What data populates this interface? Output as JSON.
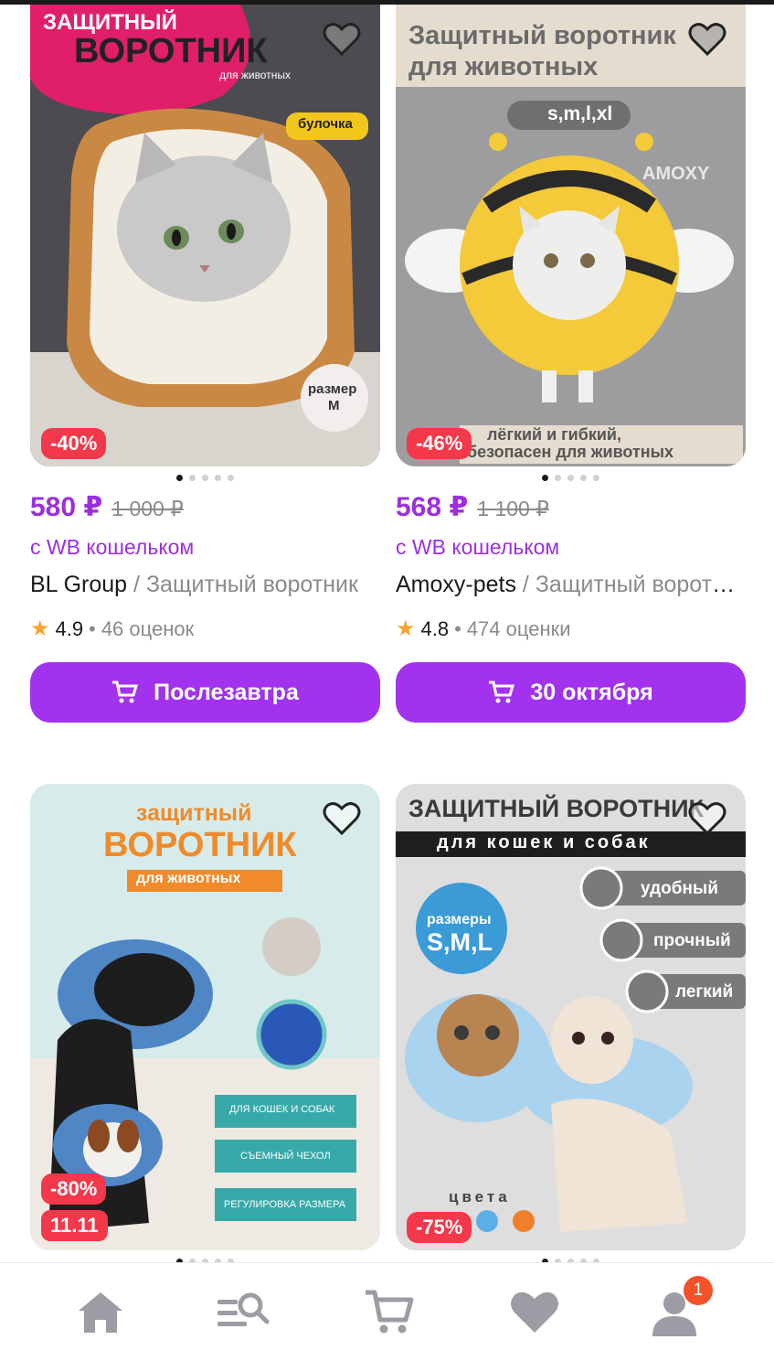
{
  "products": [
    {
      "price": "580 ₽",
      "old_price": "1 000 ₽",
      "wallet": "с WB кошельком",
      "brand": "BL Group",
      "separator": " / ",
      "name": "Защитный воротник",
      "rating": "4.9",
      "reviews": "46 оценок",
      "delivery": "Послезавтра",
      "discount": "-40%",
      "image_text": {
        "t1": "ЗАЩИТНЫЙ",
        "t2": "ВОРОТНИК",
        "t3": "для животных",
        "t4": "булочка",
        "t5": "размер",
        "t6": "M"
      }
    },
    {
      "price": "568 ₽",
      "old_price": "1 100 ₽",
      "wallet": "с WB кошельком",
      "brand": "Amoxy-pets",
      "separator": " / ",
      "name": "Защитный воротник",
      "rating": "4.8",
      "reviews": "474 оценки",
      "delivery": "30 октября",
      "discount": "-46%",
      "image_text": {
        "t1": "Защитный воротник",
        "t2": "для животных",
        "t3": "s,m,l,xl",
        "t4": "AMOXY",
        "t5": "лёгкий и гибкий,",
        "t6": "безопасен для животных"
      }
    },
    {
      "discount": "-80%",
      "promo": "11.11",
      "image_text": {
        "t1": "защитный",
        "t2": "ВОРОТНИК",
        "t3": "для животных",
        "t4": "ДЛЯ КОШЕК И СОБАК",
        "t5": "СЪЕМНЫЙ ЧЕХОЛ",
        "t6": "РЕГУЛИРОВКА РАЗМЕРА"
      }
    },
    {
      "discount": "-75%",
      "image_text": {
        "t1": "ЗАЩИТНЫЙ ВОРОТНИК",
        "t2": "для кошек и собак",
        "t3": "размеры",
        "t4": "S,M,L",
        "t5": "удобный",
        "t6": "прочный",
        "t7": "легкий",
        "t8": "цвета"
      }
    }
  ],
  "nav": {
    "items": [
      "home-icon",
      "catalog-search-icon",
      "cart-icon",
      "favorites-icon",
      "profile-icon"
    ],
    "profile_badge": "1"
  },
  "colors": {
    "accent": "#a232ee",
    "price": "#9b2fe0",
    "discount": "#f2384a",
    "badge": "#f2512a",
    "star": "#f7a531"
  }
}
